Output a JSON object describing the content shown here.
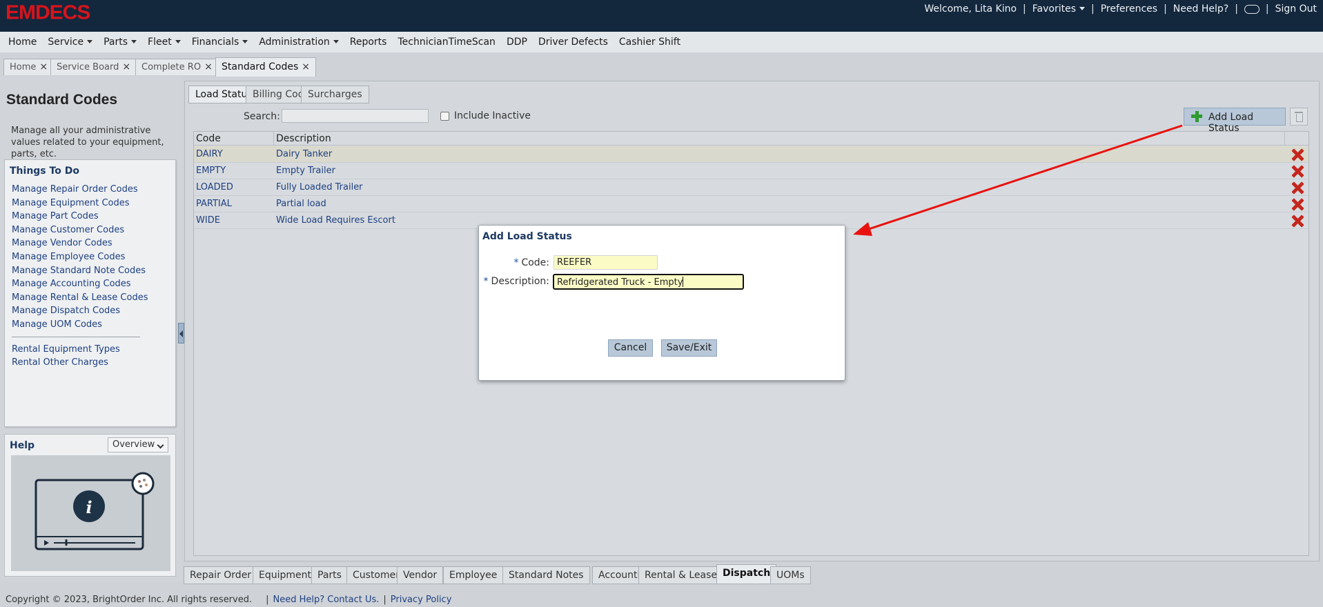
{
  "app": {
    "logo": "EMDECS"
  },
  "topbar": {
    "welcome": "Welcome, Lita Kino",
    "favorites": "Favorites",
    "preferences": "Preferences",
    "need_help": "Need Help?",
    "sign_out": "Sign Out"
  },
  "menu": {
    "items": [
      {
        "label": "Home",
        "dropdown": false
      },
      {
        "label": "Service",
        "dropdown": true
      },
      {
        "label": "Parts",
        "dropdown": true
      },
      {
        "label": "Fleet",
        "dropdown": true
      },
      {
        "label": "Financials",
        "dropdown": true
      },
      {
        "label": "Administration",
        "dropdown": true
      },
      {
        "label": "Reports",
        "dropdown": false
      },
      {
        "label": "TechnicianTimeScan",
        "dropdown": false
      },
      {
        "label": "DDP",
        "dropdown": false
      },
      {
        "label": "Driver Defects",
        "dropdown": false
      },
      {
        "label": "Cashier Shift",
        "dropdown": false
      }
    ]
  },
  "page_tabs": [
    {
      "label": "Home",
      "active": false
    },
    {
      "label": "Service Board",
      "active": false
    },
    {
      "label": "Complete RO",
      "active": false
    },
    {
      "label": "Standard Codes",
      "active": true
    }
  ],
  "left": {
    "title": "Standard Codes",
    "description": "Manage all your administrative values related to your equipment, parts, etc.",
    "todo_title": "Things To Do",
    "todo_links": [
      "Manage Repair Order Codes",
      "Manage Equipment Codes",
      "Manage Part Codes",
      "Manage Customer Codes",
      "Manage Vendor Codes",
      "Manage Employee Codes",
      "Manage Standard Note Codes",
      "Manage Accounting Codes",
      "Manage Rental & Lease Codes",
      "Manage Dispatch Codes",
      "Manage UOM Codes"
    ],
    "rental_links": [
      "Rental Equipment Types",
      "Rental Other Charges"
    ],
    "help_title": "Help",
    "help_select": "Overview"
  },
  "sub_tabs": [
    {
      "label": "Load Status",
      "active": true
    },
    {
      "label": "Billing Codes",
      "active": false
    },
    {
      "label": "Surcharges",
      "active": false
    }
  ],
  "toolbar": {
    "search_label": "Search:",
    "search_value": "",
    "include_inactive": "Include Inactive",
    "add_button": "Add Load Status"
  },
  "table": {
    "columns": [
      "Code",
      "Description"
    ],
    "rows": [
      {
        "code": "DAIRY",
        "description": "Dairy Tanker"
      },
      {
        "code": "EMPTY",
        "description": "Empty Trailer"
      },
      {
        "code": "LOADED",
        "description": "Fully Loaded Trailer"
      },
      {
        "code": "PARTIAL",
        "description": "Partial load"
      },
      {
        "code": "WIDE",
        "description": "Wide Load Requires Escort"
      }
    ]
  },
  "dialog": {
    "title": "Add Load Status",
    "code_label": "Code:",
    "code_value": "REEFER",
    "description_label": "Description:",
    "description_value": "Refridgerated Truck - Empty",
    "required_mark": "*",
    "cancel": "Cancel",
    "save": "Save/Exit"
  },
  "bottom_tabs": [
    {
      "label": "Repair Order",
      "active": false
    },
    {
      "label": "Equipment",
      "active": false
    },
    {
      "label": "Parts",
      "active": false
    },
    {
      "label": "Customer",
      "active": false
    },
    {
      "label": "Vendor",
      "active": false
    },
    {
      "label": "Employee",
      "active": false
    },
    {
      "label": "Standard Notes",
      "active": false
    },
    {
      "label": "Accounting",
      "active": false
    },
    {
      "label": "Rental & Lease",
      "active": false
    },
    {
      "label": "Dispatch",
      "active": true
    },
    {
      "label": "UOMs",
      "active": false
    }
  ],
  "footer": {
    "copyright": "Copyright © 2023, BrightOrder Inc. All rights reserved.",
    "help_link": "Need Help? Contact Us.",
    "privacy": "Privacy Policy"
  },
  "colors": {
    "topbar": "#13273d",
    "logo": "#d7141c",
    "annotation_arrow": "#e8120f"
  }
}
